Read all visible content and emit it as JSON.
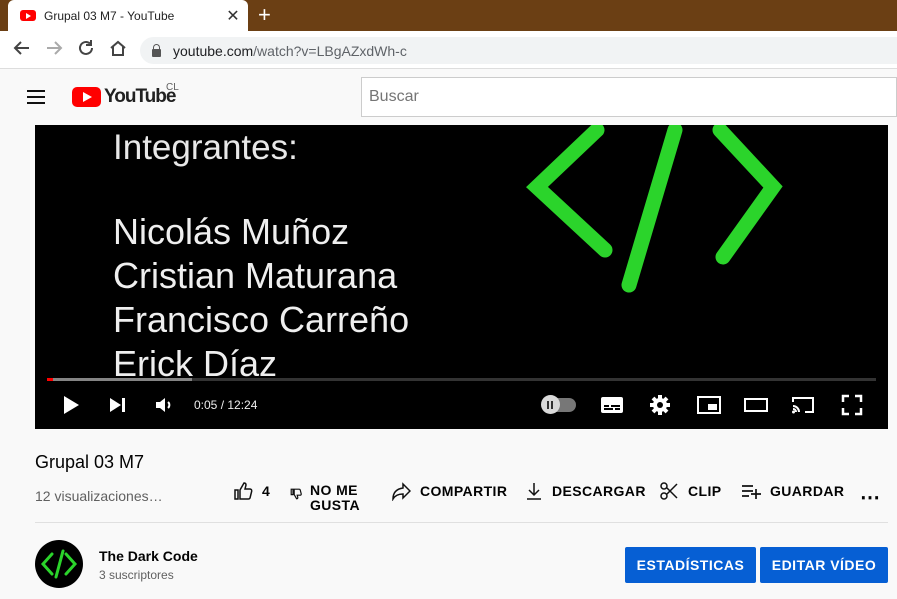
{
  "browser": {
    "tab_title": "Grupal 03 M7 - YouTube",
    "tab_close": "✕",
    "new_tab": "+",
    "url_host": "youtube.com",
    "url_path": "/watch?v=LBgAZxdWh-c"
  },
  "masthead": {
    "logo_text": "YouTube",
    "country_code": "CL",
    "search_placeholder": "Buscar"
  },
  "video_slide": {
    "heading": "Integrantes:",
    "members": [
      "Nicolás Muñoz",
      "Cristian Maturana",
      "Francisco Carreño",
      "Erick Díaz"
    ]
  },
  "player": {
    "timecode": "0:05 / 12:24",
    "progress_played_fraction": 0.007,
    "progress_loaded_fraction": 0.175
  },
  "video": {
    "title": "Grupal 03 M7",
    "views": "12 visualizaciones…"
  },
  "actions": {
    "like_count": "4",
    "dislike_line1": "NO ME",
    "dislike_line2": "GUSTA",
    "share": "COMPARTIR",
    "download": "DESCARGAR",
    "clip": "CLIP",
    "save": "GUARDAR",
    "more": "⋯"
  },
  "channel": {
    "name": "The Dark Code",
    "subscribers": "3 suscriptores"
  },
  "owner_buttons": {
    "stats": "ESTADÍSTICAS",
    "edit": "EDITAR VÍDEO"
  },
  "colors": {
    "youtube_red": "#ff0000",
    "tabstrip": "#6b3f14",
    "button_blue": "#065fd4",
    "code_green": "#2bd42b"
  }
}
